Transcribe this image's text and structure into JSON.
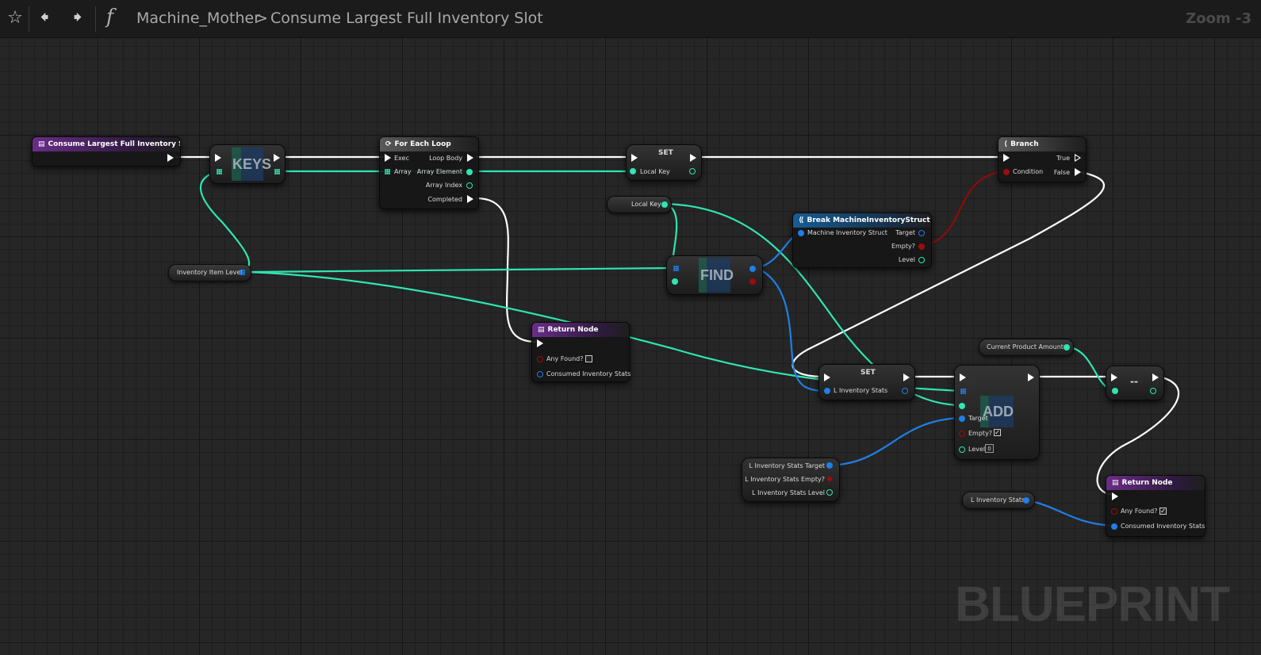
{
  "toolbar": {
    "favorite_icon": "star-icon",
    "back_icon": "arrow-left-icon",
    "forward_icon": "arrow-right-icon",
    "function_icon": "function-icon",
    "breadcrumb_parent": "Machine_Mother",
    "breadcrumb_separator": ">",
    "breadcrumb_current": "Consume Largest Full Inventory Slot",
    "zoom": "Zoom -3"
  },
  "watermark": "BLUEPRINT",
  "colors": {
    "exec": "#ffffff",
    "struct_map": "#2ee6b0",
    "struct_blue": "#1f7fe6",
    "boolean": "#9b0d0d",
    "function_entry": "#6a2d88",
    "break_struct": "#155d95"
  },
  "nodes": {
    "entry": {
      "title": "Consume Largest Full Inventory Slot"
    },
    "keys": {
      "title": "KEYS"
    },
    "foreach": {
      "title": "For Each Loop",
      "exec": "Exec",
      "array": "Array",
      "loop_body": "Loop Body",
      "array_element": "Array Element",
      "array_index": "Array Index",
      "completed": "Completed"
    },
    "set1": {
      "title": "SET",
      "local_key": "Local Key"
    },
    "branch": {
      "title": "Branch",
      "condition": "Condition",
      "true": "True",
      "false": "False"
    },
    "local_key_getter": {
      "label": "Local Key"
    },
    "inventory_item_level": {
      "label": "Inventory Item Level"
    },
    "find": {
      "title": "FIND"
    },
    "break_struct": {
      "title": "Break MachineInventoryStruct",
      "input": "Machine Inventory Struct",
      "target": "Target",
      "empty": "Empty?",
      "level": "Level"
    },
    "return1": {
      "title": "Return Node",
      "any_found": "Any Found?",
      "consumed": "Consumed Inventory Stats",
      "any_found_checked": false
    },
    "set2": {
      "title": "SET",
      "l_inventory_stats": "L Inventory Stats"
    },
    "add": {
      "title": "ADD",
      "target": "Target",
      "empty": "Empty?",
      "level": "Level",
      "level_value": "0",
      "empty_checked": true
    },
    "current_product_amount": {
      "label": "Current Product Amount"
    },
    "decrement": {
      "title": "--"
    },
    "break_local": {
      "target": "L Inventory Stats Target",
      "empty": "L Inventory Stats Empty?",
      "level": "L Inventory Stats Level"
    },
    "l_inventory_stats_getter": {
      "label": "L Inventory Stats"
    },
    "return2": {
      "title": "Return Node",
      "any_found": "Any Found?",
      "consumed": "Consumed Inventory Stats",
      "any_found_checked": true
    }
  }
}
